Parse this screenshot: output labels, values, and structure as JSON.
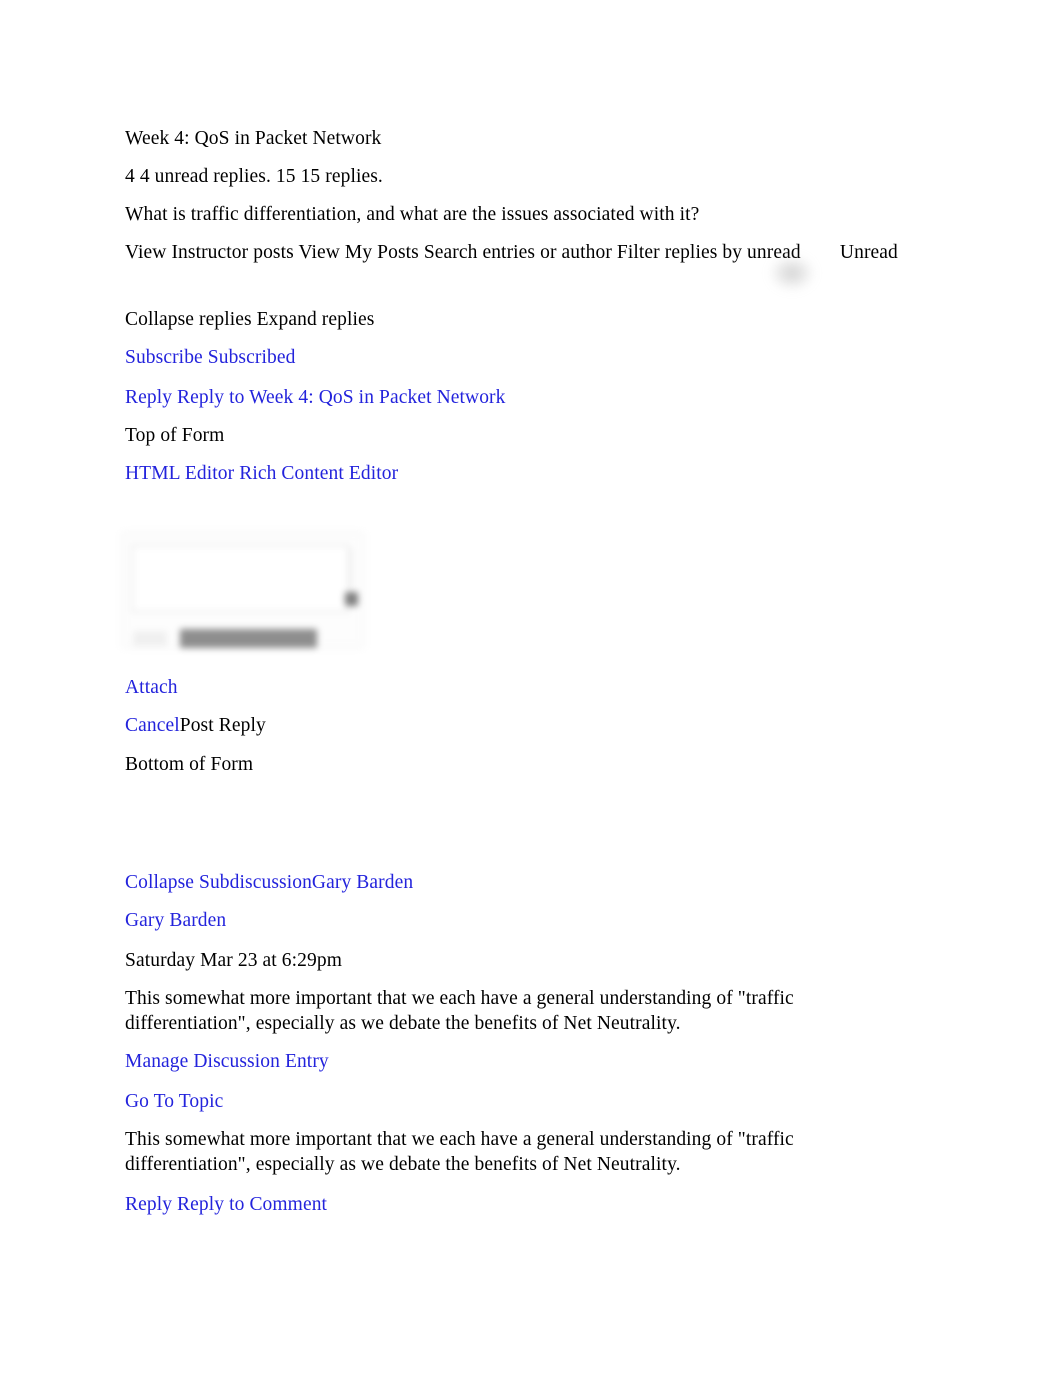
{
  "document": {
    "title": "Week 4: QoS in Packet Network",
    "colors": {
      "link": "#2323dc",
      "text": "#000000",
      "background": "#ffffff",
      "editor_bar": "#8e8e8e",
      "editor_border": "#e2e2e2"
    }
  },
  "topic": {
    "title": "Week 4: QoS in Packet Network",
    "reply_counts": "4 4 unread replies. 15 15 replies.",
    "prompt": "What is traffic differentiation, and what are the issues associated with it?"
  },
  "toolbar": {
    "view_instructor_posts": "View Instructor posts",
    "view_my_posts": "View My Posts",
    "search_label": "Search entries or author",
    "filter_label": "Filter replies by unread",
    "unread_label": "Unread",
    "line": "View Instructor posts View My Posts Search entries or author Filter replies by unread  Unread",
    "collapse_expand_line": "Collapse replies Expand replies",
    "collapse_replies": "Collapse replies",
    "expand_replies": "Expand replies"
  },
  "subscription": {
    "line": "Subscribe Subscribed",
    "subscribe": "Subscribe",
    "subscribed": "Subscribed"
  },
  "reply_top": {
    "line": "Reply Reply to Week 4: QoS in Packet Network",
    "reply": "Reply",
    "reply_to": "Reply to Week 4: QoS in Packet Network"
  },
  "form": {
    "top_marker": "Top of Form",
    "bottom_marker": "Bottom of Form",
    "editor_toggle_line": "HTML Editor Rich Content Editor",
    "html_editor": "HTML Editor",
    "rich_content_editor": "Rich Content Editor",
    "attach": "Attach",
    "cancel": "Cancel",
    "post_reply": "Post Reply",
    "editor_body_value": ""
  },
  "entry": {
    "collapse_line": "Collapse SubdiscussionGary Barden",
    "collapse_subdiscussion": "Collapse Subdiscussion",
    "author": "Gary Barden",
    "author_link": "Gary Barden",
    "timestamp": "Saturday Mar 23 at 6:29pm",
    "message": "This somewhat more important that we each have a general understanding of \"traffic differentiation\", especially as we debate the benefits of Net Neutrality.",
    "manage_discussion_entry": "Manage Discussion Entry",
    "go_to_topic": "Go To Topic",
    "message_repeat": "This somewhat more important that we each have a general understanding of \"traffic differentiation\", especially as we debate the benefits of Net Neutrality.",
    "reply_line": "Reply Reply to Comment",
    "reply": "Reply",
    "reply_to_comment": "Reply to Comment"
  }
}
